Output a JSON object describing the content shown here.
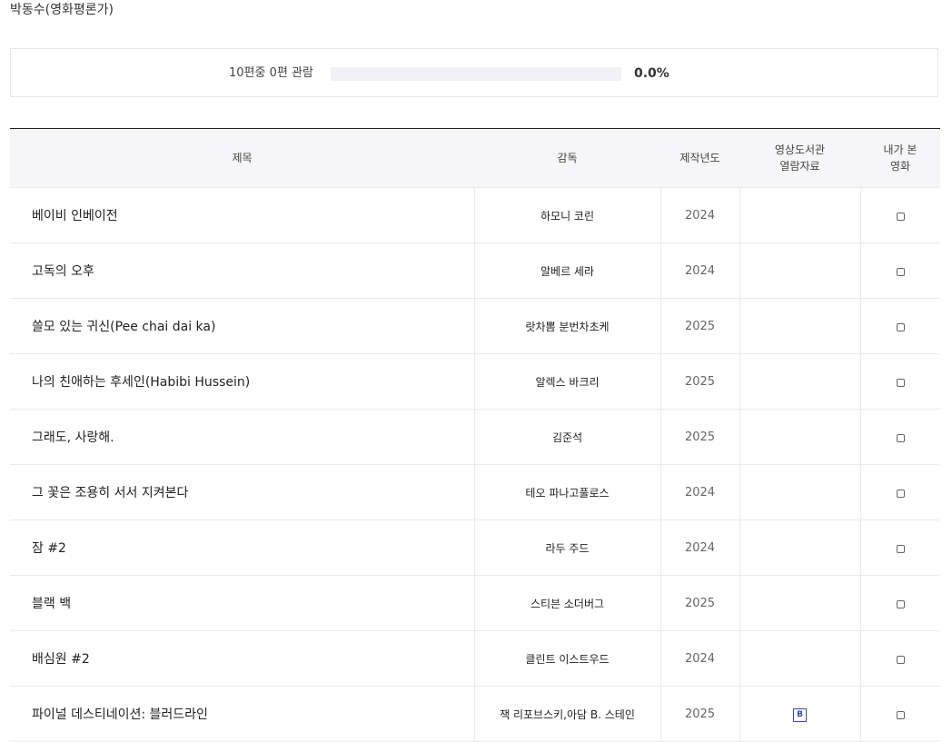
{
  "page": {
    "header": "박동수(영화평론가)"
  },
  "progress": {
    "text": "10편중 0편 관람",
    "percent_text": "0.0%",
    "fraction": 0.0
  },
  "table": {
    "headers": {
      "title": "제목",
      "director": "감독",
      "year": "제작년도",
      "archive_line1": "영상도서관",
      "archive_line2": "열람자료",
      "seen_line1": "내가 본",
      "seen_line2": "영화"
    },
    "rows": [
      {
        "title": "베이비 인베이전",
        "director": "하모니 코린",
        "year": "2024",
        "archive": false,
        "seen": false
      },
      {
        "title": "고독의 오후",
        "director": "알베르 세라",
        "year": "2024",
        "archive": false,
        "seen": false
      },
      {
        "title": "쓸모 있는 귀신(Pee chai dai ka)",
        "director": "랏차뽐 분번차초케",
        "year": "2025",
        "archive": false,
        "seen": false
      },
      {
        "title": "나의 친애하는 후세인(Habibi Hussein)",
        "director": "알렉스 바크리",
        "year": "2025",
        "archive": false,
        "seen": false
      },
      {
        "title": "그래도, 사랑해.",
        "director": "김준석",
        "year": "2025",
        "archive": false,
        "seen": false
      },
      {
        "title": "그 꽃은 조용히 서서 지켜본다",
        "director": "테오 파나고풀로스",
        "year": "2024",
        "archive": false,
        "seen": false
      },
      {
        "title": "잠 #2",
        "director": "라두 주드",
        "year": "2024",
        "archive": false,
        "seen": false
      },
      {
        "title": "블랙 백",
        "director": "스티븐 소더버그",
        "year": "2025",
        "archive": false,
        "seen": false
      },
      {
        "title": "배심원 #2",
        "director": "클린트 이스트우드",
        "year": "2024",
        "archive": false,
        "seen": false
      },
      {
        "title": "파이널 데스티네이션: 블러드라인",
        "director": "잭 리포브스키,아담 B. 스테인",
        "year": "2025",
        "archive": true,
        "archive_icon": "B",
        "seen": false
      }
    ]
  },
  "colors": {
    "accent": "#3949ab",
    "progress_track": "#f2f2f6",
    "header_bg": "#f6f6f8"
  }
}
